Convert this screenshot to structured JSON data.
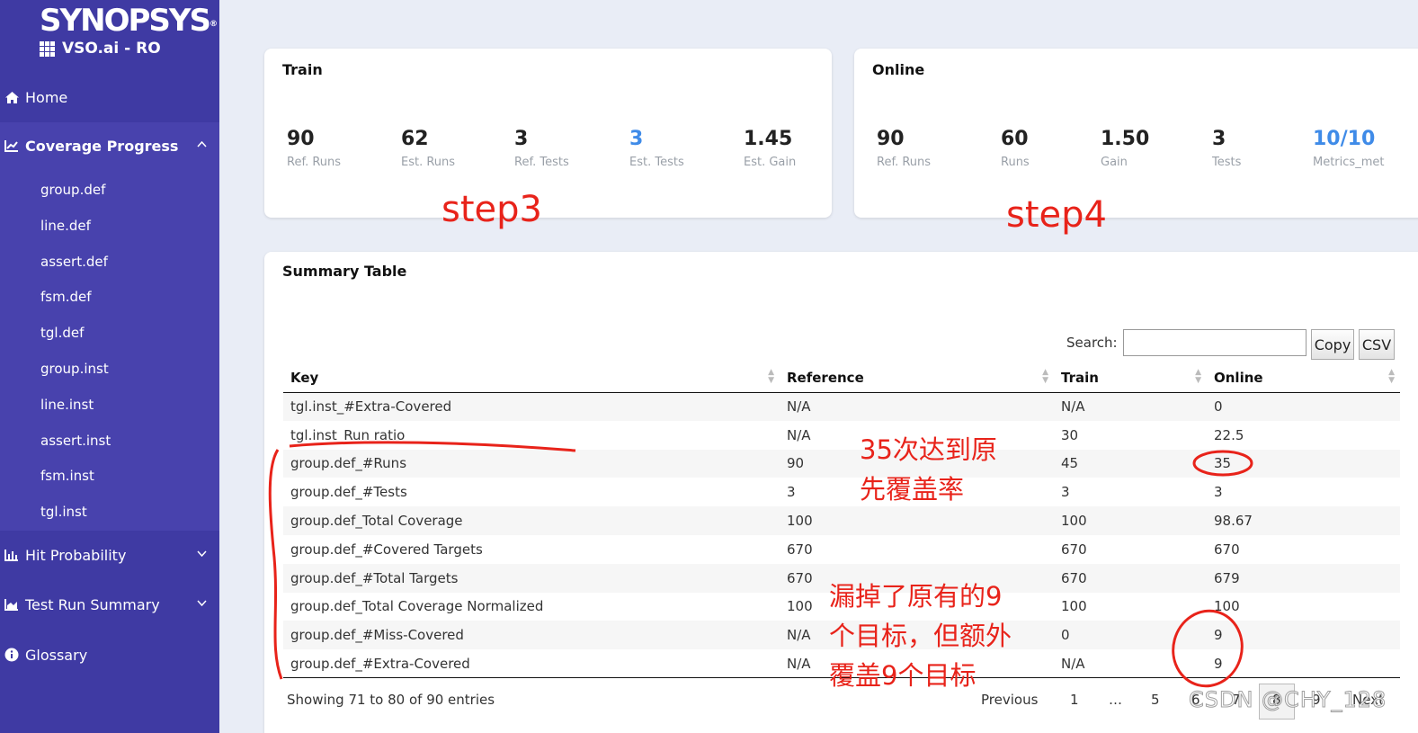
{
  "sidebar": {
    "brand": "SYNOPSYS",
    "brand_mark": "®",
    "product": "VSO.ai - RO",
    "home": "Home",
    "coverage_progress": "Coverage Progress",
    "sub_items": [
      "group.def",
      "line.def",
      "assert.def",
      "fsm.def",
      "tgl.def",
      "group.inst",
      "line.inst",
      "assert.inst",
      "fsm.inst",
      "tgl.inst"
    ],
    "hit_probability": "Hit Probability",
    "test_run_summary": "Test Run Summary",
    "glossary": "Glossary"
  },
  "train": {
    "title": "Train",
    "metrics": [
      {
        "value": "90",
        "label": "Ref. Runs"
      },
      {
        "value": "62",
        "label": "Est. Runs"
      },
      {
        "value": "3",
        "label": "Ref. Tests"
      },
      {
        "value": "3",
        "label": "Est. Tests"
      },
      {
        "value": "1.45",
        "label": "Est. Gain"
      }
    ]
  },
  "online": {
    "title": "Online",
    "metrics": [
      {
        "value": "90",
        "label": "Ref. Runs"
      },
      {
        "value": "60",
        "label": "Runs"
      },
      {
        "value": "1.50",
        "label": "Gain"
      },
      {
        "value": "3",
        "label": "Tests"
      },
      {
        "value": "10/10",
        "label": "Metrics_met"
      }
    ]
  },
  "summary": {
    "title": "Summary Table",
    "search_label": "Search:",
    "search_value": "",
    "copy_label": "Copy",
    "csv_label": "CSV",
    "columns": [
      "Key",
      "Reference",
      "Train",
      "Online"
    ],
    "rows": [
      [
        "tgl.inst_#Extra-Covered",
        "N/A",
        "N/A",
        "0"
      ],
      [
        "tgl.inst_Run ratio",
        "N/A",
        "30",
        "22.5"
      ],
      [
        "group.def_#Runs",
        "90",
        "45",
        "35"
      ],
      [
        "group.def_#Tests",
        "3",
        "3",
        "3"
      ],
      [
        "group.def_Total Coverage",
        "100",
        "100",
        "98.67"
      ],
      [
        "group.def_#Covered Targets",
        "670",
        "670",
        "670"
      ],
      [
        "group.def_#Total Targets",
        "670",
        "670",
        "679"
      ],
      [
        "group.def_Total Coverage Normalized",
        "100",
        "100",
        "100"
      ],
      [
        "group.def_#Miss-Covered",
        "N/A",
        "0",
        "9"
      ],
      [
        "group.def_#Extra-Covered",
        "N/A",
        "N/A",
        "9"
      ]
    ],
    "info": "Showing 71 to 80 of 90 entries",
    "pagination": {
      "previous": "Previous",
      "pages": [
        "1",
        "…",
        "5",
        "6",
        "7",
        "8",
        "9"
      ],
      "next": "Next"
    }
  },
  "annotations": {
    "step3": "step3",
    "step4": "step4",
    "note1_line1": "35次达到原",
    "note1_line2": "先覆盖率",
    "note2_line1": "漏掉了原有的9",
    "note2_line2": "个目标，但额外",
    "note2_line3": "覆盖9个目标"
  },
  "watermark": "CSDN @CHY_128",
  "colors": {
    "sidebar": "#3f3aa3",
    "sidebar_active": "#4842ad",
    "accent_blue": "#3f8be8",
    "annotation_red": "#e8231a",
    "page_bg": "#e9edf6"
  }
}
